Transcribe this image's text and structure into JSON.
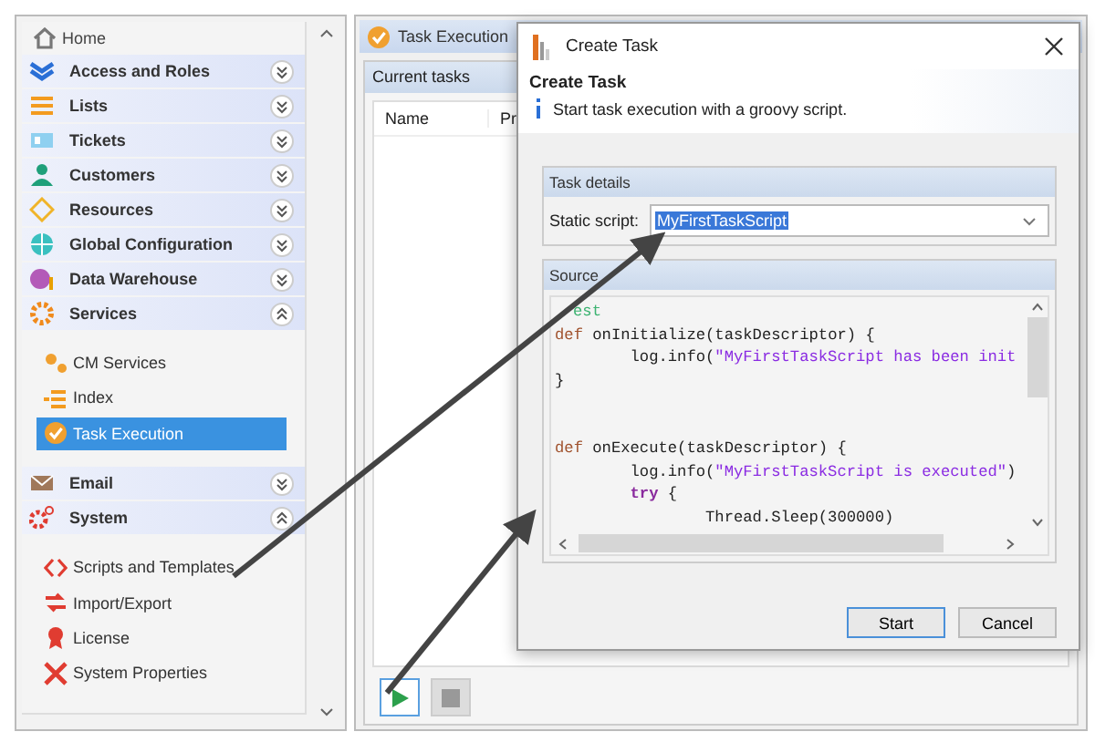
{
  "sidebar": {
    "home": "Home",
    "sections": [
      {
        "label": "Access and Roles",
        "expanded": false
      },
      {
        "label": "Lists",
        "expanded": false
      },
      {
        "label": "Tickets",
        "expanded": false
      },
      {
        "label": "Customers",
        "expanded": false
      },
      {
        "label": "Resources",
        "expanded": false
      },
      {
        "label": "Global Configuration",
        "expanded": false
      },
      {
        "label": "Data Warehouse",
        "expanded": false
      },
      {
        "label": "Services",
        "expanded": true,
        "children": [
          {
            "label": "CM Services",
            "selected": false
          },
          {
            "label": "Index",
            "selected": false
          },
          {
            "label": "Task Execution",
            "selected": true
          }
        ]
      },
      {
        "label": "Email",
        "expanded": false
      },
      {
        "label": "System",
        "expanded": true,
        "children": [
          {
            "label": "Scripts and Templates",
            "selected": false
          },
          {
            "label": "Import/Export",
            "selected": false
          },
          {
            "label": "License",
            "selected": false
          },
          {
            "label": "System Properties",
            "selected": false
          }
        ]
      }
    ]
  },
  "main": {
    "tab": "Task Execution",
    "panel_title": "Current tasks",
    "table": {
      "columns": [
        "Name",
        "Pr"
      ]
    }
  },
  "dialog": {
    "title": "Create Task",
    "heading": "Create Task",
    "description": "Start task execution with a groovy script.",
    "task_details": {
      "title": "Task details",
      "label": "Static script:",
      "value": "MyFirstTaskScript"
    },
    "source": {
      "title": "Source",
      "lines": [
        {
          "kind": "code",
          "tokens": [
            {
              "kind": "comment",
              "text": "est"
            }
          ]
        },
        {
          "kind": "code",
          "tokens": [
            {
              "kind": "keyword",
              "text": "def"
            },
            {
              "kind": "plain",
              "text": " onInitialize(taskDescriptor) {"
            }
          ]
        },
        {
          "kind": "code",
          "tokens": [
            {
              "kind": "plain",
              "text": "        log.info("
            },
            {
              "kind": "string",
              "text": "\"MyFirstTaskScript has been init"
            }
          ]
        },
        {
          "kind": "code",
          "tokens": [
            {
              "kind": "plain",
              "text": "}"
            }
          ]
        },
        {
          "kind": "blank"
        },
        {
          "kind": "blank"
        },
        {
          "kind": "code",
          "tokens": [
            {
              "kind": "keyword",
              "text": "def"
            },
            {
              "kind": "plain",
              "text": " onExecute(taskDescriptor) {"
            }
          ]
        },
        {
          "kind": "code",
          "tokens": [
            {
              "kind": "plain",
              "text": "        log.info("
            },
            {
              "kind": "string",
              "text": "\"MyFirstTaskScript is executed\""
            },
            {
              "kind": "plain",
              "text": ")"
            }
          ]
        },
        {
          "kind": "code",
          "tokens": [
            {
              "kind": "control",
              "text": "        try"
            },
            {
              "kind": "plain",
              "text": " {"
            }
          ]
        },
        {
          "kind": "code",
          "tokens": [
            {
              "kind": "plain",
              "text": "                Thread.Sleep(300000)"
            }
          ]
        }
      ]
    },
    "buttons": [
      "Start",
      "Cancel"
    ]
  }
}
